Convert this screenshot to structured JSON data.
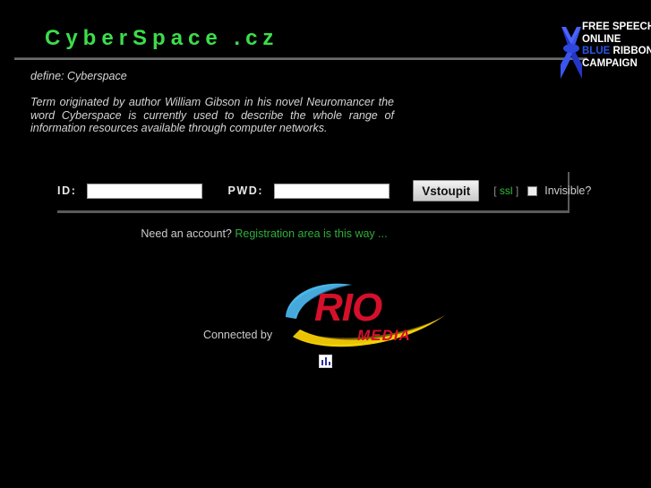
{
  "header": {
    "site_title": "CyberSpace .cz",
    "title_color": "#3cdd4b"
  },
  "ribbon_badge": {
    "line1": "FREE SPEECH",
    "line2": "ONLINE",
    "line3_blue": "BLUE",
    "line3_rest": " RIBBON",
    "line4": "CAMPAIGN",
    "ribbon_color": "#2b55e8",
    "icon": "blue-ribbon-icon"
  },
  "definition": {
    "label": "define: Cyberspace",
    "body": "Term originated by author William Gibson in his novel Neuromancer the word Cyberspace is currently used to describe the whole range of information resources available through computer networks."
  },
  "login": {
    "id_label": "ID:",
    "id_value": "",
    "id_placeholder": "",
    "pwd_label": "PWD:",
    "pwd_value": "",
    "pwd_placeholder": "",
    "submit_label": "Vstoupit",
    "ssl_open_bracket": "[ ",
    "ssl_label": "ssl",
    "ssl_close_bracket": " ]",
    "ssl_color": "#2fbe3b",
    "invisible_label": "Invisible?",
    "invisible_checked": false
  },
  "registration": {
    "need_text": "Need an account? ",
    "link_text": "Registration area is this way ...",
    "link_color": "#2fae3b"
  },
  "footer": {
    "connected_label": "Connected by",
    "logo_name": "rio-media-logo",
    "logo_word": "RIO",
    "logo_subword": "MEDIA",
    "logo_red": "#d4102a",
    "logo_blue": "#4cb6e6",
    "logo_yellow": "#f2d008",
    "counter_name": "visitor-counter-icon"
  }
}
